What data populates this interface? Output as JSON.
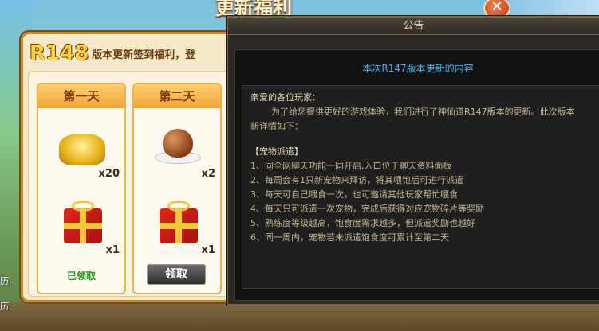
{
  "background": {
    "side_lines": [
      "历,",
      "历,"
    ]
  },
  "welfare_panel": {
    "title": "更新福利",
    "close_label": "✕",
    "banner_version": "R148",
    "banner_text": "版本更新签到福利，登",
    "days": [
      {
        "label": "第一天",
        "rewards": [
          {
            "icon": "gold-ingot-icon",
            "count": "x20"
          },
          {
            "icon": "gift-box-icon",
            "count": "x1"
          }
        ],
        "status": "已领取"
      },
      {
        "label": "第二天",
        "rewards": [
          {
            "icon": "egg-dish-icon",
            "count": "x2"
          },
          {
            "icon": "gift-box-icon",
            "count": "x1"
          }
        ],
        "button": "领取"
      }
    ]
  },
  "notice": {
    "window_title": "公告",
    "heading": "本次R147版本更新的内容",
    "greeting": "亲爱的各位玩家：",
    "intro_line1": "为了给您提供更好的游戏体验，我们进行了神仙道R147版本的更新。此次版本",
    "intro_line2": "新详情如下：",
    "section_title": "【宠物派遣】",
    "items": [
      "1、同全网聊天功能一同开启,入口位于聊天资料面板",
      "2、每周会有1只新宠物来拜访，将其喂饱后可进行派遣",
      "3、每天可自己喂食一次，也可邀请其他玩家帮忙喂食",
      "4、每天只可派遣一次宠物，完成后获得对应宠物碎片等奖励",
      "5、熟练度等级越高，饱食度需求越多，但派遣奖励也越好",
      "6、同一周内，宠物若未派遣饱食度可累计至第二天"
    ]
  }
}
